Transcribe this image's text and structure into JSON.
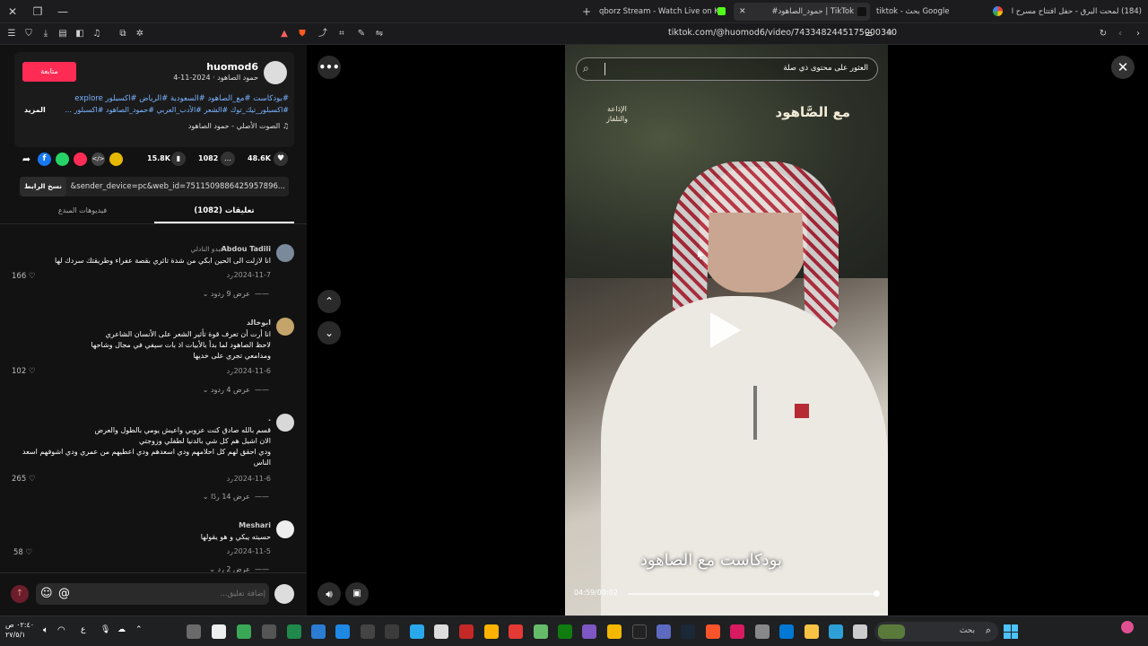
{
  "browser": {
    "tabs": [
      {
        "label": "(184) لمحت البرق - حفل افتتاح مسرح ا..."
      },
      {
        "label": "tiktok - بحث Google"
      },
      {
        "label": "#حمود_الصاهود | TikTok"
      },
      {
        "label": "qborz Stream - Watch Live on Kick"
      }
    ],
    "new_tab": "+",
    "url": "tiktok.com/@huomod6/video/7433482445175000340"
  },
  "post": {
    "username": "huomod6",
    "subtitle": "حمود الصاهود · 2024-11-4",
    "follow_label": "متابعة",
    "caption_line1": "#بودكاست #مع_الصاهود #السعودية #الرياض #اكسبلور explore",
    "caption_line2": "#اكسبلور_تيك_توك #الشعر #الأدب_العربي #حمود_الصاهود #اكسبلور ...",
    "more_label": "المزيد",
    "sound": "♫ الصوت الأصلي - حمود الصاهود",
    "likes": "48.6K",
    "comments_count": "1082",
    "saves": "15.8K",
    "link_text": "...p=1&sender_device=pc&web_id=7511509886425957896",
    "copy_link": "نسخ الرابط",
    "tab_comments": "تعليقات (1082)",
    "tab_videos": "فيديوهات المبدع"
  },
  "comments": [
    {
      "name": "Abdou Tadili",
      "sub": "عبدو التادلي",
      "text": [
        "انا لازلت الى الحين ابكي من شدة تاثري بقصة عفراء وطريقتك سردك لها"
      ],
      "date": "2024-11-7",
      "reply": "رد",
      "likes": "166",
      "replies": "عرض 9 ردود"
    },
    {
      "name": "ابوخالد",
      "sub": "",
      "text": [
        "انا أرت أن تعرف قوة تأثير الشعر على الأنسان الشاعري",
        "لاحظ الصاهود لما بدأ بالأبيات اذ بات سيفي في مجال وشاحها",
        "ومدامعي تجري على خديها"
      ],
      "date": "2024-11-6",
      "reply": "رد",
      "likes": "102",
      "replies": "عرض 4 ردود"
    },
    {
      "name": ".",
      "sub": "",
      "text": [
        "قسم بالله صادق كنت عزوبي واعيش يومي بالطول والعرض",
        "الان اشيل هم كل شي بالدنيا لطفلي وزوجتي",
        "ودي احقق لهم كل احلامهم ودي اسعدهم ودي اعطيهم من عمري ودي اشوفهم اسعد",
        "الناس"
      ],
      "date": "2024-11-6",
      "reply": "رد",
      "likes": "265",
      "replies": "عرض 14 ردًا"
    },
    {
      "name": "Meshari",
      "sub": "",
      "text": [
        "حسيته يبكي و هو يقولها"
      ],
      "date": "2024-11-5",
      "reply": "رد",
      "likes": "58",
      "replies": "عرض 2 رد"
    }
  ],
  "comment_input": {
    "placeholder": "إضافة تعليق..."
  },
  "video": {
    "search_placeholder": "العثور على محتوى ذي صلة",
    "logo_right": "مع الصَّاهود",
    "logo_left": "الإذاعة والتلفاز",
    "subtitle": "بودكاست مع الصاهود",
    "time": "04:59/00:02"
  },
  "taskbar": {
    "search_label": "بحث",
    "clock_time": "٠٢:٤٠ ص",
    "clock_date": "٢٧/٥/١",
    "lang": "ع"
  },
  "colors": {
    "accent": "#fe2c55",
    "link": "#7ab4ff"
  }
}
